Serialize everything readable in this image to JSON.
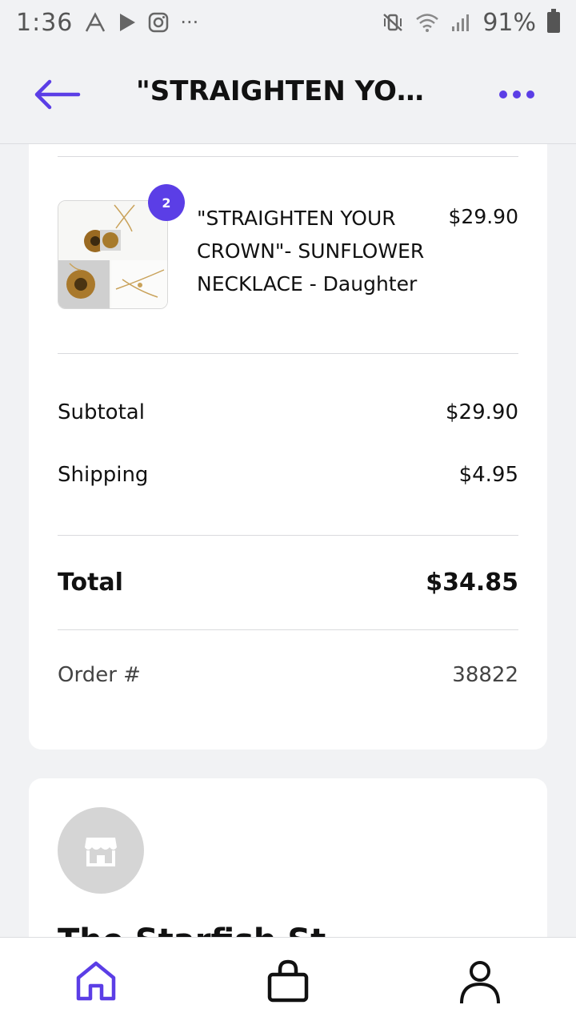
{
  "status_bar": {
    "time": "1:36",
    "battery": "91%",
    "icons": [
      "a-icon",
      "play-store-icon",
      "instagram-icon",
      "more-notifications-icon",
      "mute-vibrate-icon",
      "wifi-icon",
      "signal-icon",
      "battery-icon"
    ]
  },
  "app_bar": {
    "title": "\"STRAIGHTEN YOUR CROWN\"- SUNFLOWER NECKLACE - Daughter",
    "accent_color": "#5b3ee6"
  },
  "order": {
    "item": {
      "quantity_badge": "2",
      "name": "\"STRAIGHTEN YOUR CROWN\"- SUNFLOWER NECKLACE - Daughter",
      "price": "$29.90"
    },
    "subtotal_label": "Subtotal",
    "subtotal_value": "$29.90",
    "shipping_label": "Shipping",
    "shipping_value": "$4.95",
    "total_label": "Total",
    "total_value": "$34.85",
    "order_label": "Order #",
    "order_value": "38822"
  },
  "store": {
    "name": "The Starfish St"
  },
  "bottom_nav": {
    "items": [
      "home-icon",
      "shopping-bag-icon",
      "profile-icon"
    ],
    "active": "home-icon"
  }
}
